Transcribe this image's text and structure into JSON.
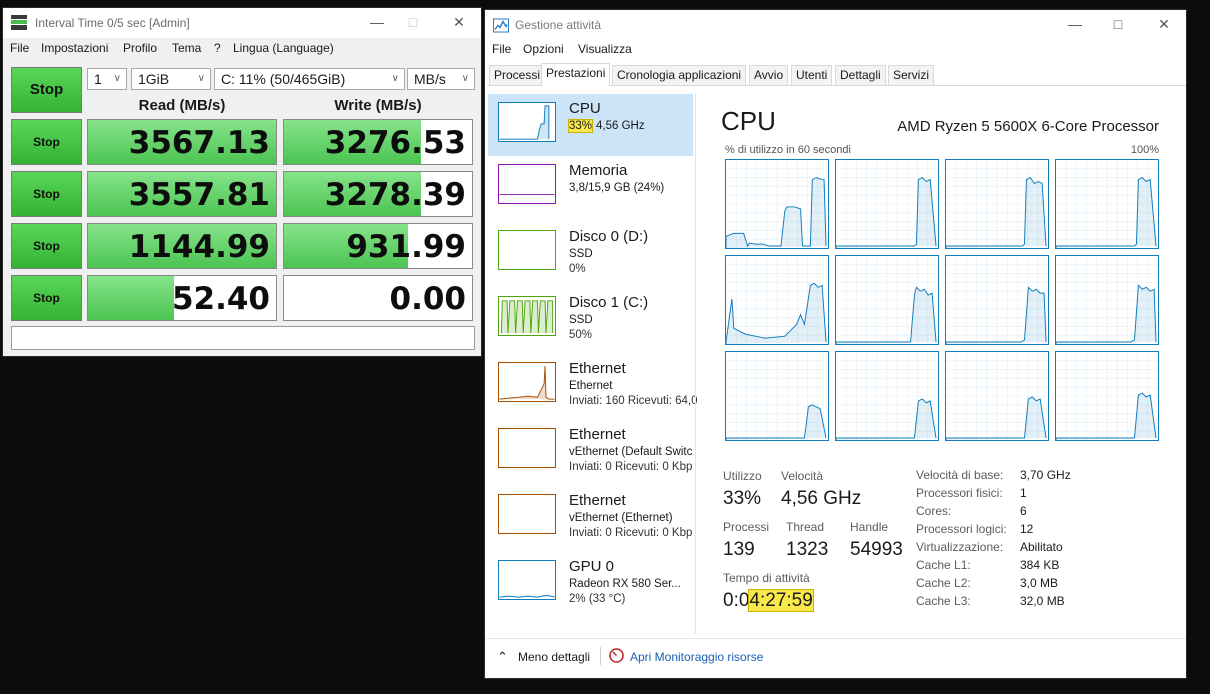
{
  "cdm": {
    "title": "Interval Time 0/5 sec [Admin]",
    "menu": [
      "File",
      "Impostazioni",
      "Profilo",
      "Tema",
      "?",
      "Lingua (Language)"
    ],
    "all_button": "Stop",
    "count": "1",
    "size": "1GiB",
    "drive": "C: 11% (50/465GiB)",
    "unit": "MB/s",
    "read_header": "Read (MB/s)",
    "write_header": "Write (MB/s)",
    "rows": [
      {
        "button": "Stop",
        "read": "3567.13",
        "write": "3276.53",
        "read_fill": 1.0,
        "write_fill": 0.73
      },
      {
        "button": "Stop",
        "read": "3557.81",
        "write": "3278.39",
        "read_fill": 1.0,
        "write_fill": 0.73
      },
      {
        "button": "Stop",
        "read": "1144.99",
        "write": "931.99",
        "read_fill": 1.0,
        "write_fill": 0.66
      },
      {
        "button": "Stop",
        "read": "52.40",
        "write": "0.00",
        "read_fill": 0.46,
        "write_fill": 0
      }
    ],
    "comment": ""
  },
  "tm": {
    "title": "Gestione attività",
    "menu": [
      "File",
      "Opzioni",
      "Visualizza"
    ],
    "tabs": [
      "Processi",
      "Prestazioni",
      "Cronologia applicazioni",
      "Avvio",
      "Utenti",
      "Dettagli",
      "Servizi"
    ],
    "active_tab": "Prestazioni",
    "sidebar": [
      {
        "name": "CPU",
        "line1": "33%",
        "line1b": "4,56 GHz",
        "line2": "",
        "color": "#117dbb"
      },
      {
        "name": "Memoria",
        "line1": "3,8/15,9 GB (24%)",
        "line2": "",
        "color": "#8b12ae"
      },
      {
        "name": "Disco 0 (D:)",
        "line1": "SSD",
        "line2": "0%",
        "color": "#4da60c"
      },
      {
        "name": "Disco 1 (C:)",
        "line1": "SSD",
        "line2": "50%",
        "color": "#4da60c"
      },
      {
        "name": "Ethernet",
        "line1": "Ethernet",
        "line2": "Inviati: 160 Ricevuti: 64,0",
        "color": "#a74f01"
      },
      {
        "name": "Ethernet",
        "line1": "vEthernet (Default Switc",
        "line2": "Inviati: 0 Ricevuti: 0 Kbp",
        "color": "#a74f01"
      },
      {
        "name": "Ethernet",
        "line1": "vEthernet (Ethernet)",
        "line2": "Inviati: 0 Ricevuti: 0 Kbp",
        "color": "#a74f01"
      },
      {
        "name": "GPU 0",
        "line1": "Radeon RX 580 Ser...",
        "line2": "2% (33 °C)",
        "color": "#117dbb"
      }
    ],
    "cpu_title": "CPU",
    "cpu_model": "AMD Ryzen 5 5600X 6-Core Processor",
    "util_label": "% di utilizzo in 60 secondi",
    "util_max": "100%",
    "stats": {
      "utilizzo_lbl": "Utilizzo",
      "utilizzo": "33%",
      "velocita_lbl": "Velocità",
      "velocita": "4,56 GHz",
      "processi_lbl": "Processi",
      "processi": "139",
      "thread_lbl": "Thread",
      "thread": "1323",
      "handle_lbl": "Handle",
      "handle": "54993",
      "uptime_lbl": "Tempo di attività",
      "uptime_a": "0:0",
      "uptime_b": "4:27:59"
    },
    "specs": [
      {
        "k": "Velocità di base:",
        "v": "3,70 GHz"
      },
      {
        "k": "Processori fisici:",
        "v": "1"
      },
      {
        "k": "Cores:",
        "v": "6"
      },
      {
        "k": "Processori logici:",
        "v": "12"
      },
      {
        "k": "Virtualizzazione:",
        "v": "Abilitato"
      },
      {
        "k": "Cache L1:",
        "v": "384 KB"
      },
      {
        "k": "Cache L2:",
        "v": "3,0 MB"
      },
      {
        "k": "Cache L3:",
        "v": "32,0 MB"
      }
    ],
    "footer": {
      "less": "Meno dettagli",
      "monitor": "Apri Monitoraggio risorse"
    }
  }
}
